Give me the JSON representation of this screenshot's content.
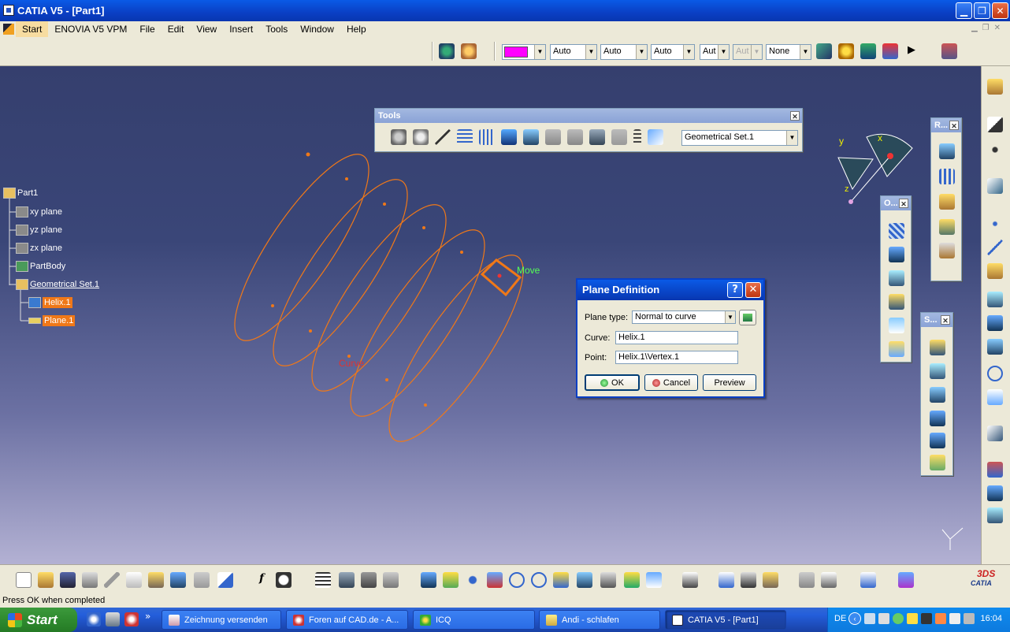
{
  "window": {
    "title": "CATIA V5 - [Part1]",
    "minimize": "▁",
    "restore": "❐",
    "close": "✕"
  },
  "menu": [
    {
      "label": "Start",
      "name": "menu-start"
    },
    {
      "label": "ENOVIA V5 VPM",
      "name": "menu-enovia"
    },
    {
      "label": "File",
      "name": "menu-file"
    },
    {
      "label": "Edit",
      "name": "menu-edit"
    },
    {
      "label": "View",
      "name": "menu-view"
    },
    {
      "label": "Insert",
      "name": "menu-insert"
    },
    {
      "label": "Tools",
      "name": "menu-tools"
    },
    {
      "label": "Window",
      "name": "menu-window"
    },
    {
      "label": "Help",
      "name": "menu-help"
    }
  ],
  "graphic_properties": {
    "color": "#ff00ff",
    "line_type": "Auto",
    "thickness": "Auto",
    "point_type": "Auto",
    "layer_short": "Aut",
    "disabled_short": "Aut",
    "layer": "None"
  },
  "tree": {
    "root": "Part1",
    "items": [
      {
        "label": "xy plane",
        "name": "tree-xy-plane"
      },
      {
        "label": "yz plane",
        "name": "tree-yz-plane"
      },
      {
        "label": "zx plane",
        "name": "tree-zx-plane"
      },
      {
        "label": "PartBody",
        "name": "tree-partbody"
      },
      {
        "label": "Geometrical Set.1",
        "name": "tree-geometrical-set"
      },
      {
        "label": "Helix.1",
        "name": "tree-helix"
      },
      {
        "label": "Plane.1",
        "name": "tree-plane"
      }
    ]
  },
  "tools_palette": {
    "title": "Tools",
    "current_set": "Geometrical Set.1"
  },
  "mini_palettes": {
    "r": "R...",
    "o": "O...",
    "s": "S..."
  },
  "viewport_labels": {
    "move": "Move",
    "curve": "Curve",
    "compass_y": "y",
    "compass_x": "x",
    "compass_z": "z"
  },
  "dialog": {
    "title": "Plane Definition",
    "help": "?",
    "close": "✕",
    "plane_type_label": "Plane type:",
    "plane_type_value": "Normal to curve",
    "curve_label": "Curve:",
    "curve_value": "Helix.1",
    "point_label": "Point:",
    "point_value": "Helix.1\\Vertex.1",
    "ok": "OK",
    "cancel": "Cancel",
    "preview": "Preview"
  },
  "status": "Press OK when completed",
  "taskbar": {
    "start": "Start",
    "quick_launch_more": "»",
    "buttons": [
      {
        "label": "Zeichnung versenden",
        "name": "task-zeichnung"
      },
      {
        "label": "Foren auf CAD.de - A...",
        "name": "task-foren"
      },
      {
        "label": "ICQ",
        "name": "task-icq"
      },
      {
        "label": "Andi - schlafen",
        "name": "task-andi"
      },
      {
        "label": "CATIA V5 - [Part1]",
        "name": "task-catia"
      }
    ],
    "lang": "DE",
    "clock": "16:04"
  },
  "brand": {
    "logo": "CATIA",
    "ds": "3DS"
  },
  "colors": {
    "selection_orange": "#f07818",
    "viewport_top": "#353f6e",
    "viewport_bottom": "#b3b1d3",
    "xp_blue": "#245edb"
  }
}
